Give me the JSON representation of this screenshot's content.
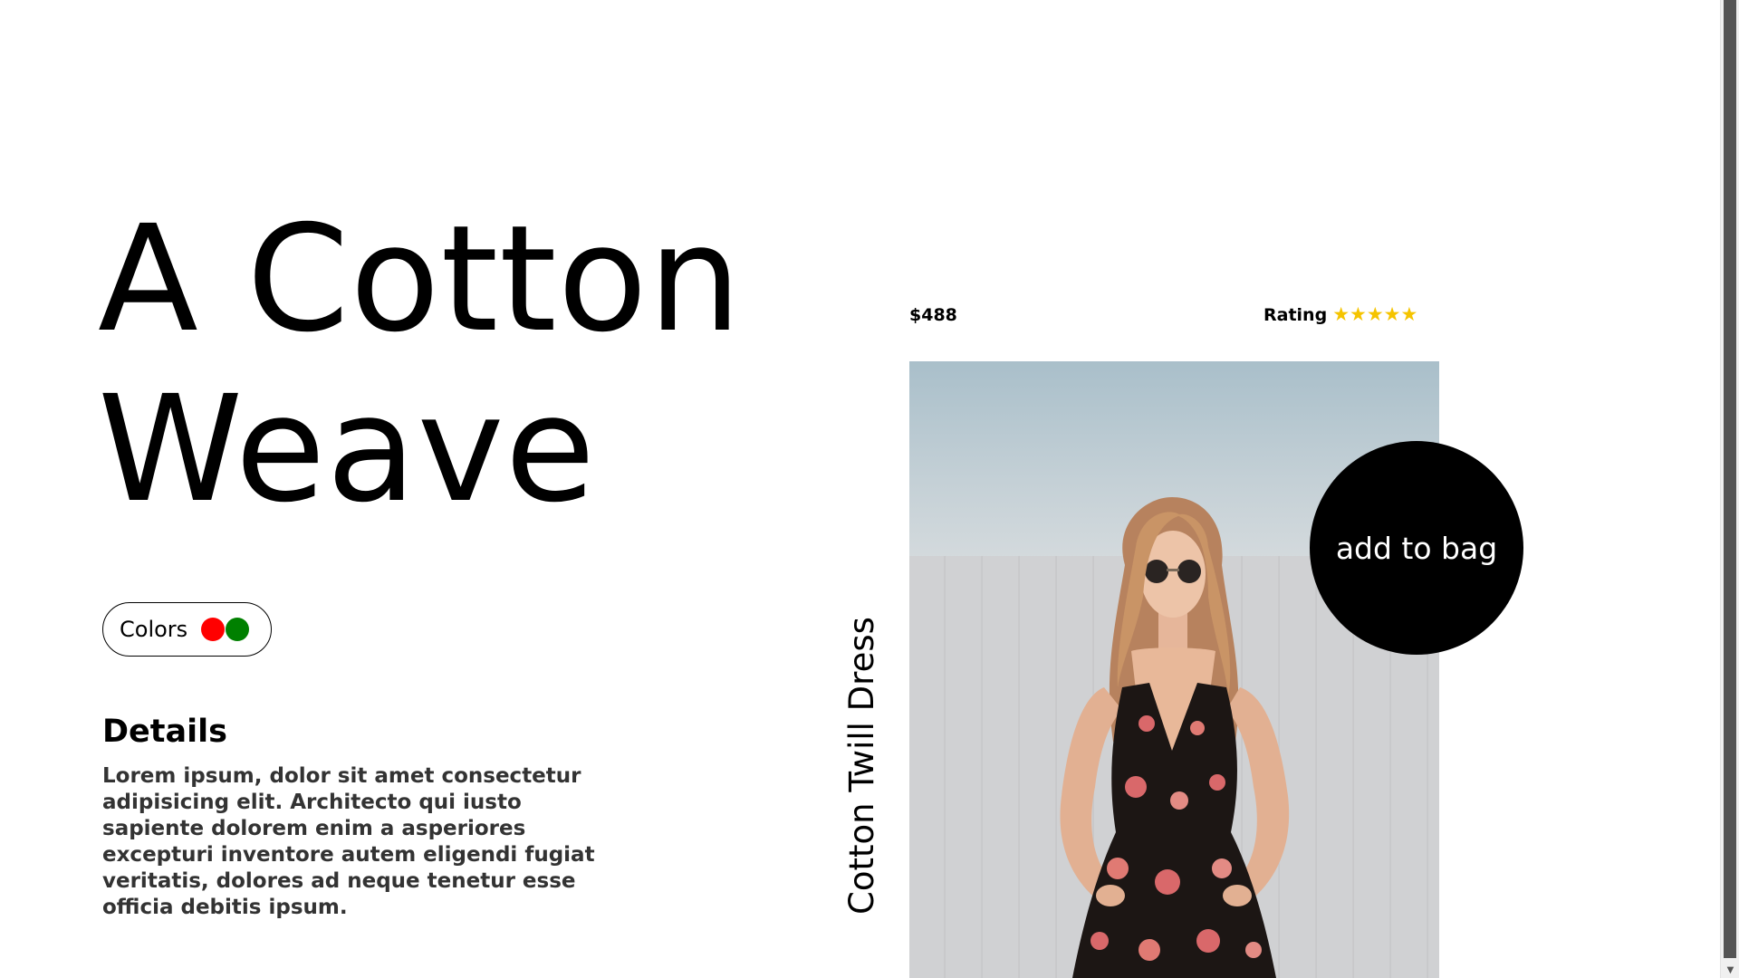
{
  "hero": {
    "title_line1": "A Cotton",
    "title_line2": "Weave"
  },
  "colors": {
    "label": "Colors",
    "swatches": [
      "#ff0000",
      "#008000"
    ]
  },
  "details": {
    "heading": "Details",
    "body": "Lorem ipsum, dolor sit amet consectetur adipisicing elit. Architecto qui iusto sapiente dolorem enim a asperiores excepturi inventore autem eligendi fugiat veritatis, dolores ad neque tenetur esse officia debitis ipsum."
  },
  "product": {
    "price": "$488",
    "rating_label": "Rating",
    "rating_stars": 5,
    "rating_max": 5,
    "star_glyph": "★",
    "star_color": "#f5c400",
    "name": "Cotton Twill Dress",
    "add_to_bag_label": "add to bag"
  },
  "icons": {
    "scroll_up": "▲",
    "scroll_down": "▼"
  }
}
